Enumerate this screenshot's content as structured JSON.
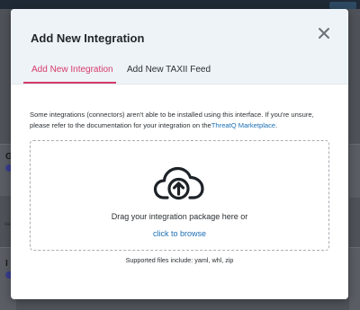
{
  "modal": {
    "title": "Add New Integration",
    "close_icon": "close-icon"
  },
  "tabs": [
    {
      "label": "Add New Integration",
      "active": true
    },
    {
      "label": "Add New TAXII Feed",
      "active": false
    }
  ],
  "info": {
    "text": "Some integrations (connectors) aren't able to be installed using this interface. If you're unsure, please refer to the documentation for your integration on the",
    "link": "ThreatQ Marketplace",
    "suffix": "."
  },
  "dropzone": {
    "icon": "cloud-upload-icon",
    "instruction": "Drag your integration package here or",
    "browse_link": "click to browse"
  },
  "supported_files": "Supported files include: yaml, whl, zip",
  "background": {
    "letters": [
      "G",
      "I"
    ],
    "snippet": "va"
  },
  "colors": {
    "accent": "#d63b6b",
    "link": "#1b6fb4",
    "header_bg": "#eef3f7"
  }
}
